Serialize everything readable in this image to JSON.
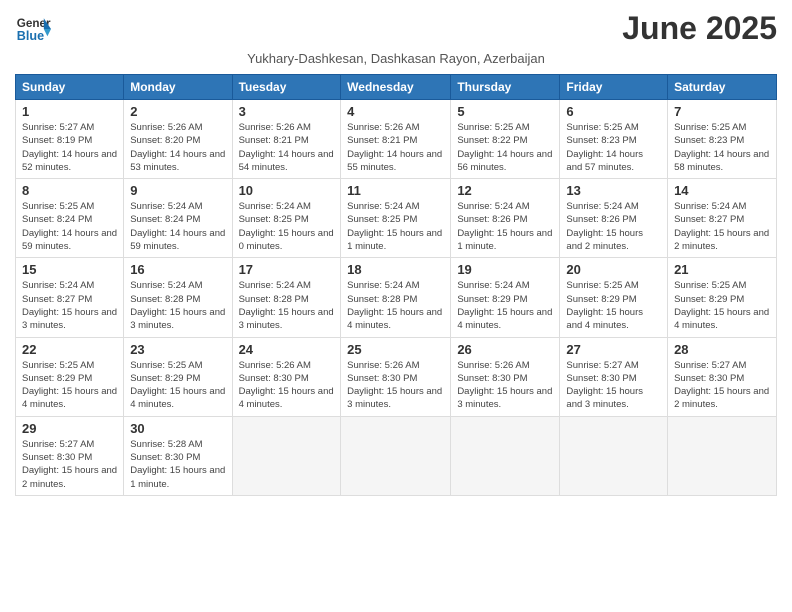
{
  "logo": {
    "line1": "General",
    "line2": "Blue"
  },
  "title": "June 2025",
  "subtitle": "Yukhary-Dashkesan, Dashkasan Rayon, Azerbaijan",
  "weekdays": [
    "Sunday",
    "Monday",
    "Tuesday",
    "Wednesday",
    "Thursday",
    "Friday",
    "Saturday"
  ],
  "weeks": [
    [
      {
        "day": "1",
        "sunrise": "5:27 AM",
        "sunset": "8:19 PM",
        "daylight": "14 hours and 52 minutes."
      },
      {
        "day": "2",
        "sunrise": "5:26 AM",
        "sunset": "8:20 PM",
        "daylight": "14 hours and 53 minutes."
      },
      {
        "day": "3",
        "sunrise": "5:26 AM",
        "sunset": "8:21 PM",
        "daylight": "14 hours and 54 minutes."
      },
      {
        "day": "4",
        "sunrise": "5:26 AM",
        "sunset": "8:21 PM",
        "daylight": "14 hours and 55 minutes."
      },
      {
        "day": "5",
        "sunrise": "5:25 AM",
        "sunset": "8:22 PM",
        "daylight": "14 hours and 56 minutes."
      },
      {
        "day": "6",
        "sunrise": "5:25 AM",
        "sunset": "8:23 PM",
        "daylight": "14 hours and 57 minutes."
      },
      {
        "day": "7",
        "sunrise": "5:25 AM",
        "sunset": "8:23 PM",
        "daylight": "14 hours and 58 minutes."
      }
    ],
    [
      {
        "day": "8",
        "sunrise": "5:25 AM",
        "sunset": "8:24 PM",
        "daylight": "14 hours and 59 minutes."
      },
      {
        "day": "9",
        "sunrise": "5:24 AM",
        "sunset": "8:24 PM",
        "daylight": "14 hours and 59 minutes."
      },
      {
        "day": "10",
        "sunrise": "5:24 AM",
        "sunset": "8:25 PM",
        "daylight": "15 hours and 0 minutes."
      },
      {
        "day": "11",
        "sunrise": "5:24 AM",
        "sunset": "8:25 PM",
        "daylight": "15 hours and 1 minute."
      },
      {
        "day": "12",
        "sunrise": "5:24 AM",
        "sunset": "8:26 PM",
        "daylight": "15 hours and 1 minute."
      },
      {
        "day": "13",
        "sunrise": "5:24 AM",
        "sunset": "8:26 PM",
        "daylight": "15 hours and 2 minutes."
      },
      {
        "day": "14",
        "sunrise": "5:24 AM",
        "sunset": "8:27 PM",
        "daylight": "15 hours and 2 minutes."
      }
    ],
    [
      {
        "day": "15",
        "sunrise": "5:24 AM",
        "sunset": "8:27 PM",
        "daylight": "15 hours and 3 minutes."
      },
      {
        "day": "16",
        "sunrise": "5:24 AM",
        "sunset": "8:28 PM",
        "daylight": "15 hours and 3 minutes."
      },
      {
        "day": "17",
        "sunrise": "5:24 AM",
        "sunset": "8:28 PM",
        "daylight": "15 hours and 3 minutes."
      },
      {
        "day": "18",
        "sunrise": "5:24 AM",
        "sunset": "8:28 PM",
        "daylight": "15 hours and 4 minutes."
      },
      {
        "day": "19",
        "sunrise": "5:24 AM",
        "sunset": "8:29 PM",
        "daylight": "15 hours and 4 minutes."
      },
      {
        "day": "20",
        "sunrise": "5:25 AM",
        "sunset": "8:29 PM",
        "daylight": "15 hours and 4 minutes."
      },
      {
        "day": "21",
        "sunrise": "5:25 AM",
        "sunset": "8:29 PM",
        "daylight": "15 hours and 4 minutes."
      }
    ],
    [
      {
        "day": "22",
        "sunrise": "5:25 AM",
        "sunset": "8:29 PM",
        "daylight": "15 hours and 4 minutes."
      },
      {
        "day": "23",
        "sunrise": "5:25 AM",
        "sunset": "8:29 PM",
        "daylight": "15 hours and 4 minutes."
      },
      {
        "day": "24",
        "sunrise": "5:26 AM",
        "sunset": "8:30 PM",
        "daylight": "15 hours and 4 minutes."
      },
      {
        "day": "25",
        "sunrise": "5:26 AM",
        "sunset": "8:30 PM",
        "daylight": "15 hours and 3 minutes."
      },
      {
        "day": "26",
        "sunrise": "5:26 AM",
        "sunset": "8:30 PM",
        "daylight": "15 hours and 3 minutes."
      },
      {
        "day": "27",
        "sunrise": "5:27 AM",
        "sunset": "8:30 PM",
        "daylight": "15 hours and 3 minutes."
      },
      {
        "day": "28",
        "sunrise": "5:27 AM",
        "sunset": "8:30 PM",
        "daylight": "15 hours and 2 minutes."
      }
    ],
    [
      {
        "day": "29",
        "sunrise": "5:27 AM",
        "sunset": "8:30 PM",
        "daylight": "15 hours and 2 minutes."
      },
      {
        "day": "30",
        "sunrise": "5:28 AM",
        "sunset": "8:30 PM",
        "daylight": "15 hours and 1 minute."
      },
      null,
      null,
      null,
      null,
      null
    ]
  ]
}
